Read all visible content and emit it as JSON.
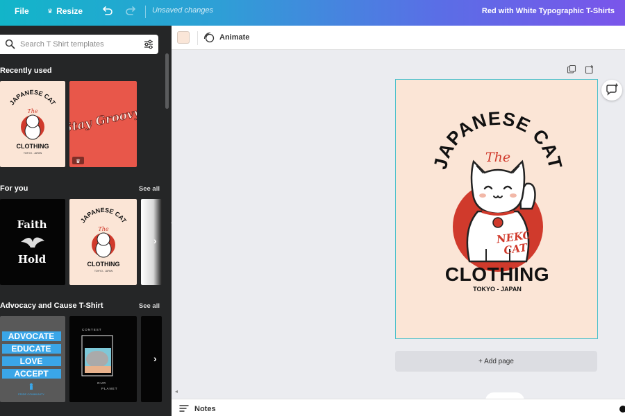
{
  "topbar": {
    "file_label": "File",
    "resize_label": "Resize",
    "status": "Unsaved changes",
    "document_title": "Red with White Typographic T-Shirts"
  },
  "side_panel": {
    "search_placeholder": "Search T Shirt templates",
    "sections": [
      {
        "title": "Recently used",
        "see_all": ""
      },
      {
        "title": "For you",
        "see_all": "See all"
      },
      {
        "title": "Advocacy and Cause T-Shirt",
        "see_all": "See all"
      }
    ],
    "thumbnails": {
      "recent_1": {
        "top": "JAPANESE CAT",
        "mid": "The",
        "bottom": "CLOTHING",
        "sub": "TOKYO - JAPAN"
      },
      "recent_2": {
        "text": "Stay Groovy"
      },
      "foryou_1": {
        "line1": "Faith",
        "line2": "Hold"
      },
      "foryou_2": {
        "top": "JAPANESE CAT",
        "mid": "The",
        "bottom": "CLOTHING",
        "sub": "TOKYO - JAPAN"
      },
      "advocacy_1": {
        "lines": [
          "ADVOCATE",
          "EDUCATE",
          "LOVE",
          "ACCEPT"
        ],
        "sub": "PRIDE COMMUNITY"
      },
      "advocacy_2": {
        "top": "CONTEST",
        "bottom1": "OUR",
        "bottom2": "PLANET"
      }
    }
  },
  "toolbar": {
    "color_swatch": "#fae6d8",
    "animate_label": "Animate"
  },
  "canvas": {
    "design": {
      "arc_text": "JAPANESE CAT",
      "script_text": "The",
      "badge_line1": "NEKO",
      "badge_line2": "CAT",
      "main_text": "CLOTHING",
      "sub_text": "TOKYO - JAPAN",
      "background": "#fbe5d6",
      "accent": "#d03a2c"
    },
    "add_page_label": "+ Add page"
  },
  "bottombar": {
    "notes_label": "Notes"
  },
  "icons": [
    "undo-icon",
    "redo-icon",
    "search-icon",
    "filter-icon",
    "animate-icon",
    "copy-page-icon",
    "add-page-icon",
    "comment-icon",
    "notes-icon",
    "chevron-left-icon",
    "chevron-right-icon",
    "crown-icon"
  ]
}
